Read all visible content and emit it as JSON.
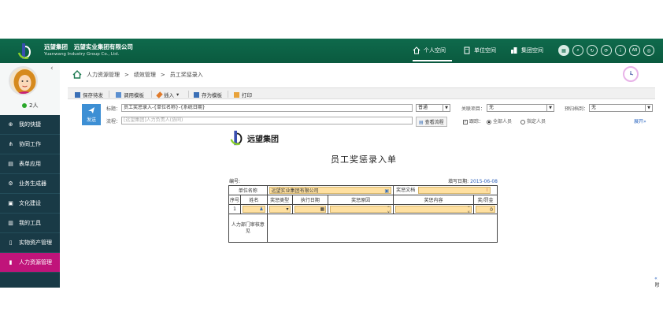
{
  "brand": {
    "name": "远望集团",
    "company": "远望实业集团有限公司",
    "company_en": "Yuanwang Industry Group Co., Ltd."
  },
  "topnav": [
    {
      "label": "个人空间",
      "icon": "home-icon"
    },
    {
      "label": "单位空间",
      "icon": "building-icon"
    },
    {
      "label": "集团空间",
      "icon": "group-icon"
    }
  ],
  "tools": [
    "apps-icon",
    "search-icon",
    "refresh-icon",
    "sync-icon",
    "info-icon",
    "ab-icon",
    "settings-icon"
  ],
  "tool_ab": "AB",
  "sidebar": {
    "online": "2人",
    "items": [
      {
        "label": "我的快捷",
        "icon": "plus-circle-icon"
      },
      {
        "label": "协同工作",
        "icon": "share-icon"
      },
      {
        "label": "表单应用",
        "icon": "form-icon"
      },
      {
        "label": "业务生成器",
        "icon": "gear-icon"
      },
      {
        "label": "文化建设",
        "icon": "book-icon"
      },
      {
        "label": "我的工具",
        "icon": "toolbox-icon"
      },
      {
        "label": "实物资产管理",
        "icon": "document-icon"
      },
      {
        "label": "人力资源管理",
        "icon": "person-doc-icon"
      }
    ]
  },
  "breadcrumb": [
    "人力资源管理",
    "绩效管理",
    "员工奖惩录入"
  ],
  "toolbar": [
    {
      "label": "保存待发",
      "icon": "save-icon"
    },
    {
      "label": "调用模板",
      "icon": "template-icon"
    },
    {
      "label": "插入",
      "icon": "insert-icon",
      "dropdown": true
    },
    {
      "label": "存为模板",
      "icon": "save-template-icon"
    },
    {
      "label": "打印",
      "icon": "print-icon"
    }
  ],
  "form": {
    "send": "发送",
    "title_label": "标题：",
    "title_value": "员工奖惩录入-{单位名称}-{系统日期}",
    "priority": "普通",
    "related_label": "关联项目：",
    "related_value": "无",
    "archive_label": "预归档到：",
    "archive_value": "无",
    "flow_label": "流程：",
    "flow_placeholder": "[远望集团]人力负责人(协同)",
    "view_flow": "查看流程",
    "track_label": "跟踪：",
    "all_people": "全部人员",
    "specific_people": "指定人员",
    "expand": "展开",
    "attach": "附言"
  },
  "document": {
    "logo_text": "远望集团",
    "title": "员工奖惩录入单",
    "no_label": "编号:",
    "date_label": "填写日期:",
    "date_value": "2015-06-08",
    "unit_label": "单位名称",
    "unit_value": "远望实业集团有限公司",
    "reward_doc_label": "奖惩文档",
    "columns": [
      "序号",
      "姓名",
      "奖惩类型",
      "执行日期",
      "奖惩原因",
      "奖惩内容",
      "奖/罚金"
    ],
    "row_no": "1",
    "amount": "0",
    "opinion_label": "人力部门审核意见"
  }
}
